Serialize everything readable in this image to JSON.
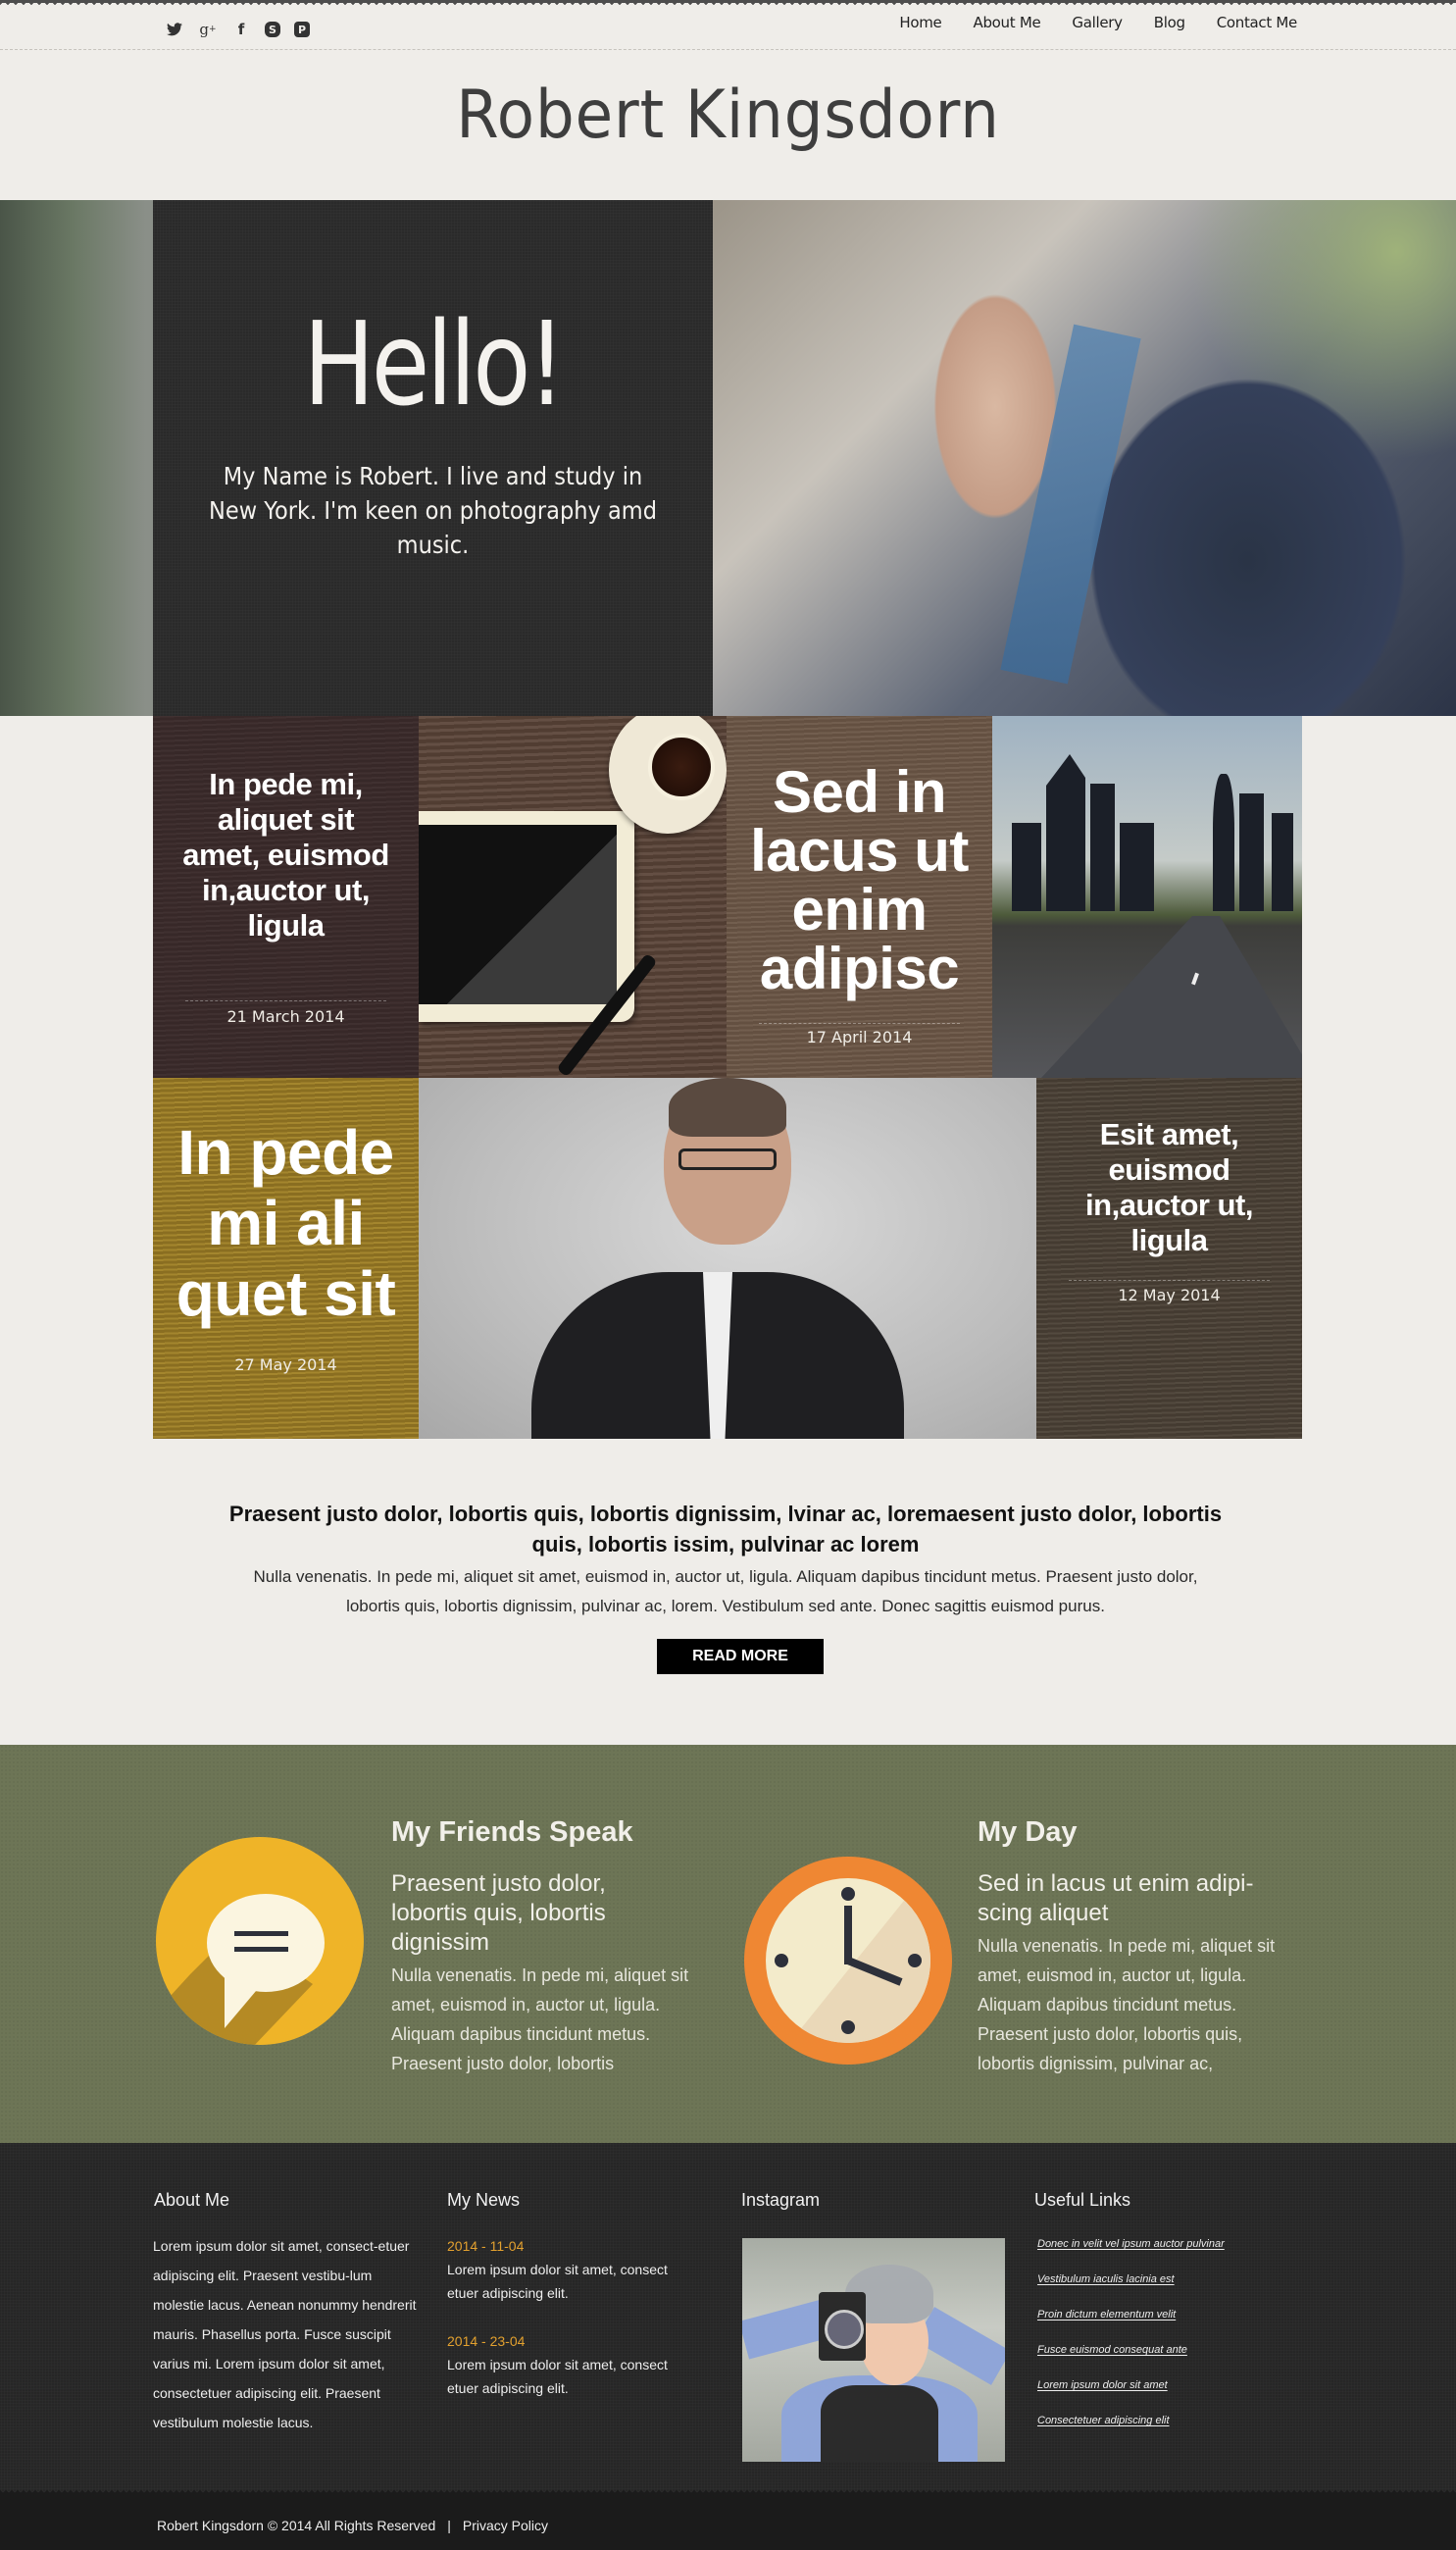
{
  "header": {
    "social_icons": [
      {
        "name": "twitter-icon",
        "glyph": "🐦"
      },
      {
        "name": "google-plus-icon",
        "glyph": "g+"
      },
      {
        "name": "facebook-icon",
        "glyph": "f"
      },
      {
        "name": "skype-icon",
        "glyph": "S"
      },
      {
        "name": "pinterest-icon",
        "glyph": "P"
      }
    ],
    "nav": [
      "Home",
      "About Me",
      "Gallery",
      "Blog",
      "Contact Me"
    ],
    "site_title": "Robert Kingsdorn"
  },
  "hero": {
    "heading": "Hello!",
    "text": "My Name is Robert. I live and study in New York. I'm keen on photography amd music."
  },
  "tiles": [
    {
      "title": "In pede mi, aliquet sit amet, euismod in,auctor ut, ligula",
      "date": "21 March 2014",
      "color": "#3a2a2a"
    },
    {
      "title": "Sed in lacus ut enim adipisc",
      "date": "17 April 2014",
      "color": "#6b5646"
    },
    {
      "title": "In pede mi ali quet sit",
      "date": "27 May 2014",
      "color": "#9a7b25"
    },
    {
      "title": "Esit amet, euismod in,auctor ut, ligula",
      "date": "12 May 2014",
      "color": "#4a4035"
    }
  ],
  "intro": {
    "title": "Praesent justo dolor, lobortis quis, lobortis dignissim, lvinar ac, loremaesent justo dolor, lobortis quis, lobortis issim, pulvinar ac lorem",
    "body": "Nulla venenatis. In pede mi, aliquet sit amet, euismod in, auctor ut, ligula. Aliquam dapibus tincidunt metus. Praesent justo dolor, lobortis quis, lobortis dignissim, pulvinar ac, lorem. Vestibulum sed ante. Donec sagittis euismod purus.",
    "button": "READ MORE"
  },
  "features": [
    {
      "heading": "My Friends Speak",
      "subheading": "Praesent justo dolor, lobortis quis, lobortis dignissim",
      "body": "Nulla venenatis. In pede mi, aliquet sit amet, euismod in, auctor ut, ligula. Aliquam dapibus tincidunt metus. Praesent justo dolor, lobortis",
      "icon": "speech-bubble-icon",
      "icon_color": "#efb428"
    },
    {
      "heading": "My Day",
      "subheading": "Sed in lacus ut enim adipi-scing aliquet",
      "body": "Nulla venenatis. In pede mi, aliquet sit amet, euismod in, auctor ut, ligula. Aliquam dapibus tincidunt metus. Praesent justo dolor, lobortis quis, lobortis dignissim, pulvinar ac,",
      "icon": "clock-icon",
      "icon_color": "#ef8733"
    }
  ],
  "footer": {
    "about": {
      "heading": "About Me",
      "body": "Lorem ipsum dolor sit amet, consect-etuer adipiscing elit. Praesent vestibu-lum molestie lacus. Aenean nonummy hendrerit mauris. Phasellus porta. Fusce suscipit varius mi. Lorem ipsum dolor sit amet, consectetuer adipiscing elit. Praesent vestibulum molestie lacus."
    },
    "news": {
      "heading": "My News",
      "items": [
        {
          "date": "2014 - 11-04",
          "text": "Lorem ipsum dolor sit amet, consect etuer adipiscing elit."
        },
        {
          "date": "2014 - 23-04",
          "text": "Lorem ipsum dolor sit amet, consect etuer adipiscing elit."
        }
      ]
    },
    "instagram": {
      "heading": "Instagram"
    },
    "links": {
      "heading": "Useful Links",
      "items": [
        "Donec in velit vel ipsum auctor pulvinar",
        "Vestibulum iaculis lacinia est",
        "Proin dictum elementum velit",
        "Fusce euismod consequat ante",
        "Lorem ipsum dolor sit amet",
        "Consectetuer adipiscing elit"
      ]
    },
    "copyright": "Robert Kingsdorn © 2014 All Rights Reserved",
    "separator": "|",
    "privacy": "Privacy Policy"
  },
  "colors": {
    "page_bg": "#efede9",
    "green_band": "#6d7556",
    "footer_bg": "#262626",
    "news_date": "#e3a12f"
  }
}
